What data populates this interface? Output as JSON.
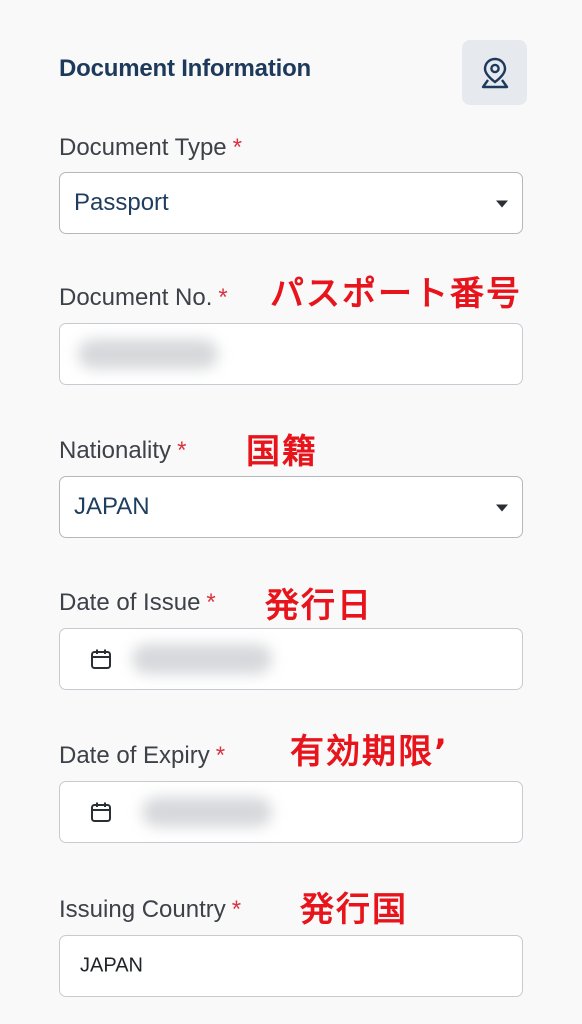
{
  "section": {
    "title": "Document Information"
  },
  "location_button": {
    "icon": "map-pin-icon"
  },
  "document_type": {
    "label": "Document Type",
    "required": "*",
    "value": "Passport"
  },
  "document_no": {
    "label": "Document No.",
    "required": "*",
    "annotation": "パスポート番号",
    "value": ""
  },
  "nationality": {
    "label": "Nationality",
    "required": "*",
    "annotation": "国籍",
    "value": "JAPAN"
  },
  "date_of_issue": {
    "label": "Date of Issue",
    "required": "*",
    "annotation": "発行日",
    "value": ""
  },
  "date_of_expiry": {
    "label": "Date of Expiry",
    "required": "*",
    "annotation": "有効期限’",
    "value": ""
  },
  "issuing_country": {
    "label": "Issuing Country",
    "required": "*",
    "annotation": "発行国",
    "value": "JAPAN"
  },
  "colors": {
    "title": "#1d3a5c",
    "required": "#d9333f",
    "annotation": "#e8141c"
  }
}
